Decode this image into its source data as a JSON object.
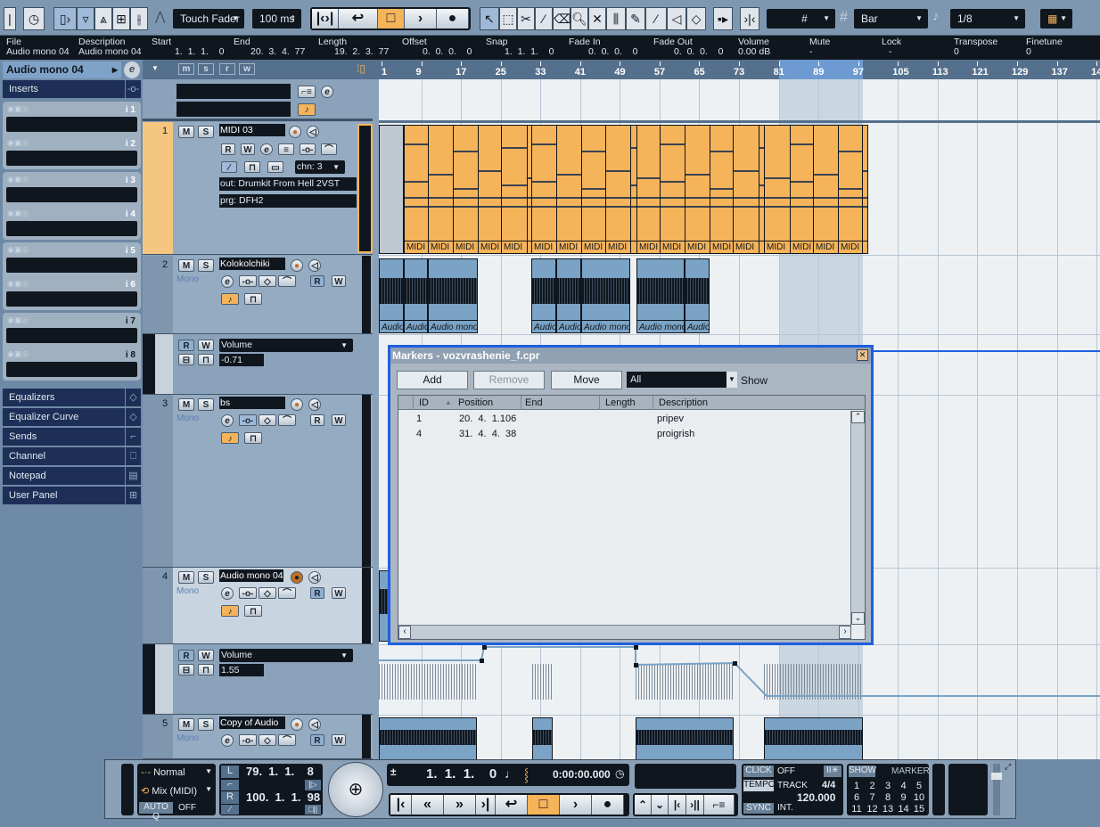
{
  "colors": {
    "midi_event": "#f5b35a",
    "audio_event": "#7aa3c6",
    "selection_blue": "#1f5fe0",
    "dark_panel": "#10161e",
    "cycle_region": "#c9d6df"
  },
  "toolbar": {
    "automation_mode": "Touch Fader",
    "crossfade_time": "100 ms",
    "snap_type": "Bar",
    "quantize": "1/8",
    "grid_icon": "grid-icon"
  },
  "info_line": {
    "fields": [
      {
        "label": "File",
        "value": "Audio mono 04"
      },
      {
        "label": "Description",
        "value": "Audio mono 04"
      },
      {
        "label": "Start",
        "value": "1.  1.  1.    0"
      },
      {
        "label": "End",
        "value": "20.  3.  4.  77"
      },
      {
        "label": "Length",
        "value": "19.  2.  3.  77"
      },
      {
        "label": "Offset",
        "value": "0.  0.  0.    0"
      },
      {
        "label": "Snap",
        "value": "1.  1.  1.    0"
      },
      {
        "label": "Fade In",
        "value": "0.  0.  0.    0"
      },
      {
        "label": "Fade Out",
        "value": "0.  0.  0.    0"
      },
      {
        "label": "Volume",
        "value": "0.00 dB"
      },
      {
        "label": "Mute",
        "value": "-"
      },
      {
        "label": "Lock",
        "value": "-"
      },
      {
        "label": "Transpose",
        "value": "0"
      },
      {
        "label": "Finetune",
        "value": "0"
      }
    ]
  },
  "inspector": {
    "track_name": "Audio mono 04",
    "inserts_label": "Inserts",
    "insert_slots": [
      "i 1",
      "i 2",
      "i 3",
      "i 4",
      "i 5",
      "i 6",
      "i 7",
      "i 8"
    ],
    "sections": [
      "Equalizers",
      "Equalizer Curve",
      "Sends",
      "Channel",
      "Notepad",
      "User Panel"
    ]
  },
  "track_list_header": {
    "buttons": [
      "m",
      "s",
      "r",
      "w"
    ]
  },
  "track_buttons": {
    "mute": "M",
    "solo": "S",
    "read": "R",
    "write": "W",
    "edit": "e"
  },
  "tracks": [
    {
      "number": "1",
      "name": "MIDI 03",
      "channel": "chn: 3",
      "output": "out: Drumkit From Hell 2VST",
      "program": "prg: DFH2"
    },
    {
      "number": "2",
      "name": "Kolokolchiki",
      "mode": "Mono",
      "automation": {
        "parameter": "Volume",
        "value": "-0.71"
      }
    },
    {
      "number": "3",
      "name": "bs",
      "mode": "Mono"
    },
    {
      "number": "4",
      "name": "Audio mono 04",
      "mode": "Mono",
      "selected": true,
      "automation": {
        "parameter": "Volume",
        "value": "1.55"
      }
    },
    {
      "number": "5",
      "name": "Copy of Audio",
      "mode": "Mono"
    }
  ],
  "ruler": {
    "bars": [
      "1",
      "9",
      "17",
      "25",
      "33",
      "41",
      "49",
      "57",
      "65",
      "73",
      "81",
      "89",
      "97",
      "105",
      "113",
      "121",
      "129",
      "137",
      "145"
    ],
    "cycle": {
      "from_bar": 81,
      "to_bar": 97
    }
  },
  "events": {
    "midi_label": "MIDI",
    "audio_label": "Audio mono 04"
  },
  "markers_window": {
    "title": "Markers - vozvrashenie_f.cpr",
    "buttons": {
      "add": "Add",
      "remove": "Remove",
      "move": "Move"
    },
    "filter": {
      "value": "All",
      "label": "Show"
    },
    "columns": [
      "ID",
      "Position",
      "End",
      "Length",
      "Description"
    ],
    "rows": [
      {
        "id": "1",
        "position": "20.  4.  1.106",
        "end": "",
        "length": "",
        "description": "pripev"
      },
      {
        "id": "4",
        "position": "31.  4.  4.  38",
        "end": "",
        "length": "",
        "description": "proigrish"
      }
    ]
  },
  "transport": {
    "record_mode": "Normal",
    "cycle_record_mode": "Mix (MIDI)",
    "auto_q": {
      "label": "AUTO Q",
      "value": "OFF"
    },
    "left_locator": {
      "label": "L",
      "value": "79.  1.  1.    8"
    },
    "right_locator": {
      "label": "R",
      "value": "100.  1.  1.  98"
    },
    "position_bars": "1.  1.  1.    0",
    "position_time": "0:00:00.000",
    "click": {
      "label": "CLICK",
      "value": "OFF"
    },
    "tempo": {
      "label": "TEMPO",
      "mode": "TRACK",
      "signature": "4/4",
      "bpm": "120.000"
    },
    "sync": {
      "label": "SYNC",
      "value": "INT."
    },
    "markers": {
      "show_label": "SHOW",
      "marker_label": "MARKER",
      "numbers": [
        "1",
        "2",
        "3",
        "4",
        "5",
        "6",
        "7",
        "8",
        "9",
        "10",
        "11",
        "12",
        "13",
        "14",
        "15"
      ]
    }
  }
}
